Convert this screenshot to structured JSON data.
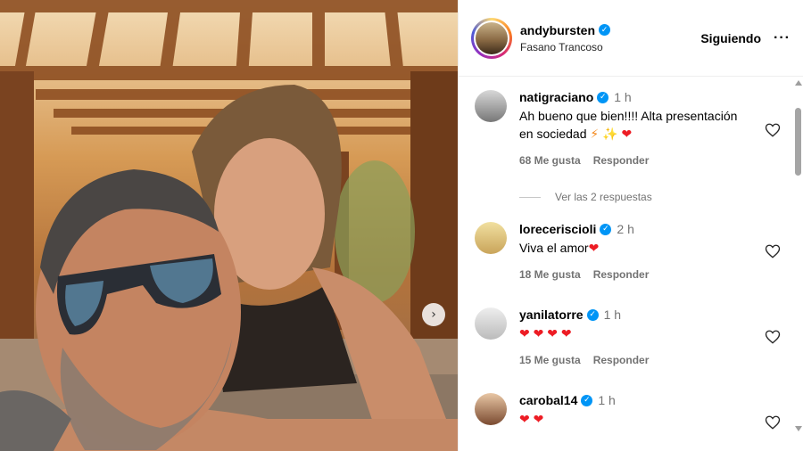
{
  "post": {
    "username": "andybursten",
    "location": "Fasano Trancoso",
    "follow_label": "Siguiendo",
    "more_label": "···"
  },
  "comments": [
    {
      "user": "natigraciano",
      "time": "1 h",
      "text": "Ah bueno que bien!!!! Alta presentación en sociedad",
      "emoji": [
        "⚡",
        "✨",
        "❤"
      ],
      "likes": "68 Me gusta",
      "reply_label": "Responder",
      "replies_label": "Ver las 2 respuestas"
    },
    {
      "user": "loreceriscioli",
      "time": "2 h",
      "text": "Viva el amor",
      "emoji": [
        "❤"
      ],
      "likes": "18 Me gusta",
      "reply_label": "Responder"
    },
    {
      "user": "yanilatorre",
      "time": "1 h",
      "text": "",
      "emoji": [
        "❤",
        "❤",
        "❤",
        "❤"
      ],
      "likes": "15 Me gusta",
      "reply_label": "Responder"
    },
    {
      "user": "carobal14",
      "time": "1 h",
      "text": "",
      "emoji": [
        "❤",
        "❤"
      ]
    }
  ],
  "icons": {
    "next": "chevron-right-icon",
    "like": "heart-outline-icon",
    "verified": "verified-badge-icon"
  },
  "colors": {
    "verified": "#0095f6",
    "heart": "#ed1c24",
    "meta_gray": "#737373"
  }
}
